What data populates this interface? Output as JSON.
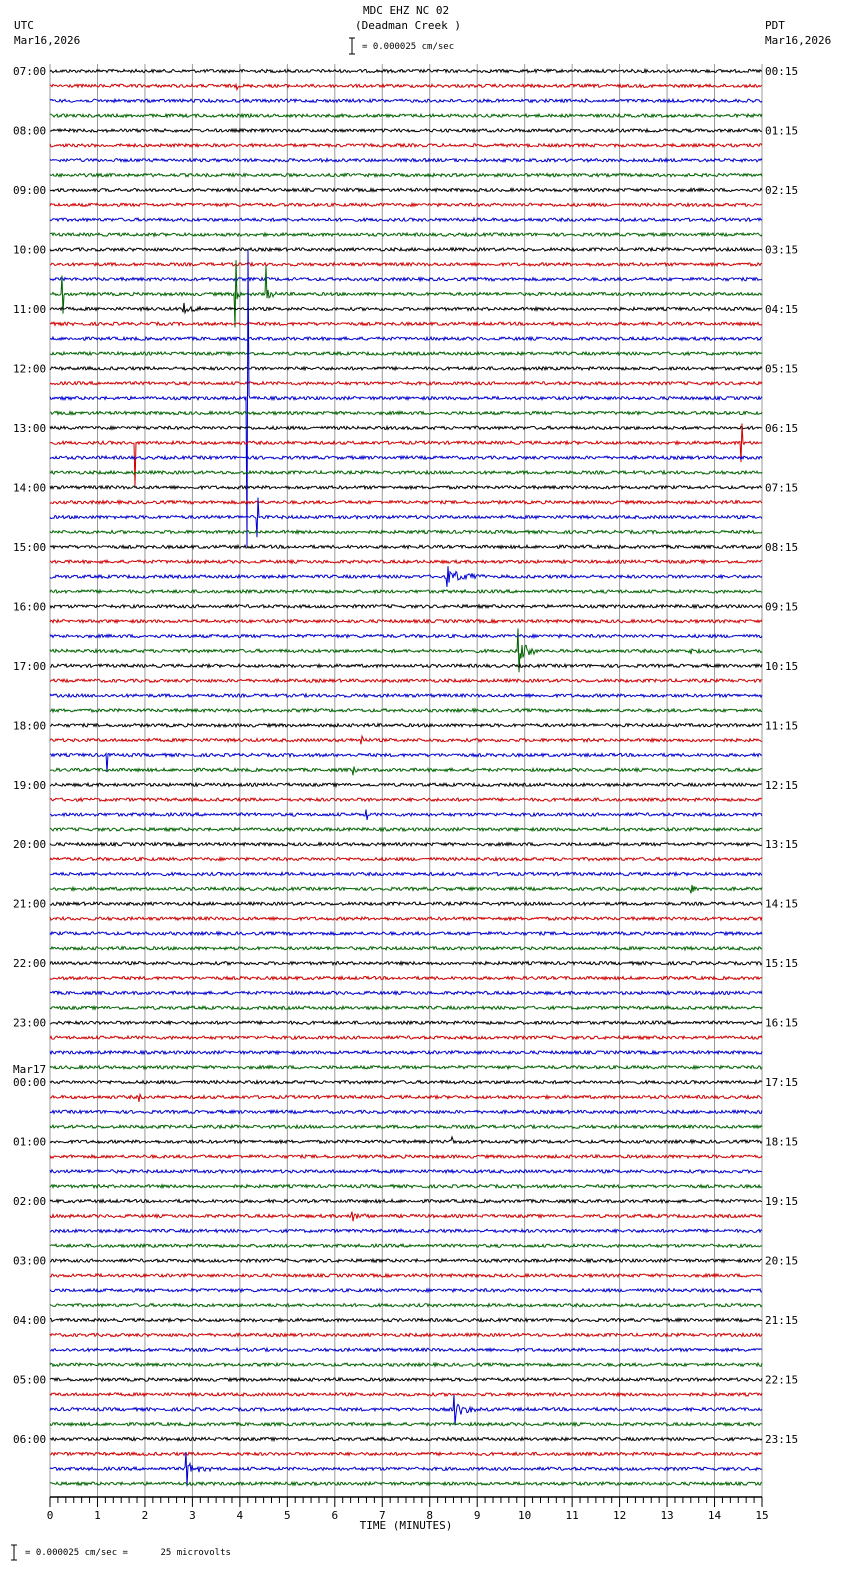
{
  "header": {
    "title": "MDC EHZ NC 02",
    "subtitle": "(Deadman Creek )",
    "scale_text": "= 0.000025 cm/sec",
    "left_tz": "UTC",
    "left_date": "Mar16,2026",
    "right_tz": "PDT",
    "right_date": "Mar16,2026"
  },
  "footer": {
    "scale_text": "= 0.000025 cm/sec =      25 microvolts"
  },
  "chart_data": {
    "type": "line",
    "title": "MDC EHZ NC 02 (Deadman Creek )",
    "xlabel": "TIME (MINUTES)",
    "xlim": [
      0,
      15
    ],
    "x_ticks": [
      "0",
      "1",
      "2",
      "3",
      "4",
      "5",
      "6",
      "7",
      "8",
      "9",
      "10",
      "11",
      "12",
      "13",
      "14",
      "15"
    ],
    "rows_per_hour": 4,
    "row_count": 96,
    "trace_colors": [
      "#000000",
      "#d00000",
      "#0000d0",
      "#006400"
    ],
    "grid": true,
    "left_labels": [
      "07:00",
      "08:00",
      "09:00",
      "10:00",
      "11:00",
      "12:00",
      "13:00",
      "14:00",
      "15:00",
      "16:00",
      "17:00",
      "18:00",
      "19:00",
      "20:00",
      "21:00",
      "22:00",
      "23:00",
      "00:00",
      "01:00",
      "02:00",
      "03:00",
      "04:00",
      "05:00",
      "06:00"
    ],
    "left_date_change": {
      "hour_index": 17,
      "label": "Mar17"
    },
    "right_labels": [
      "00:15",
      "01:15",
      "02:15",
      "03:15",
      "04:15",
      "05:15",
      "06:15",
      "07:15",
      "08:15",
      "09:15",
      "10:15",
      "11:15",
      "12:15",
      "13:15",
      "14:15",
      "15:15",
      "16:15",
      "17:15",
      "18:15",
      "19:15",
      "20:15",
      "21:15",
      "22:15",
      "23:15"
    ],
    "events": [
      {
        "row": 1,
        "minute": 3.9,
        "amp": 0.3,
        "coda": 0
      },
      {
        "row": 15,
        "minute": 0.25,
        "amp": 2.5,
        "coda": 0
      },
      {
        "row": 15,
        "minute": 3.88,
        "amp": 4.5,
        "coda": 0.3
      },
      {
        "row": 15,
        "minute": 4.53,
        "amp": 4.0,
        "coda": 0.4
      },
      {
        "row": 16,
        "minute": 2.8,
        "amp": 0.6,
        "coda": 0.7
      },
      {
        "row": 22,
        "minute": 4.15,
        "amp": 20,
        "coda": 0.1
      },
      {
        "row": 25,
        "minute": 1.77,
        "amp": 6.0,
        "coda": 0
      },
      {
        "row": 25,
        "minute": 14.55,
        "amp": 2.5,
        "coda": 0
      },
      {
        "row": 30,
        "minute": 4.35,
        "amp": 2.5,
        "coda": 0.1
      },
      {
        "row": 34,
        "minute": 8.35,
        "amp": 1.5,
        "coda": 1.2
      },
      {
        "row": 39,
        "minute": 9.85,
        "amp": 3.0,
        "coda": 0.8
      },
      {
        "row": 39,
        "minute": 13.5,
        "amp": 0.3,
        "coda": 0.6
      },
      {
        "row": 45,
        "minute": 6.55,
        "amp": 0.6,
        "coda": 0.1
      },
      {
        "row": 46,
        "minute": 1.18,
        "amp": 2.5,
        "coda": 0.1
      },
      {
        "row": 47,
        "minute": 6.38,
        "amp": 0.6,
        "coda": 0.1
      },
      {
        "row": 50,
        "minute": 6.65,
        "amp": 0.7,
        "coda": 0.05
      },
      {
        "row": 55,
        "minute": 13.5,
        "amp": 0.6,
        "coda": 0.2
      },
      {
        "row": 69,
        "minute": 1.87,
        "amp": 0.5,
        "coda": 0
      },
      {
        "row": 72,
        "minute": 8.45,
        "amp": 0.7,
        "coda": 0.2
      },
      {
        "row": 77,
        "minute": 6.35,
        "amp": 0.6,
        "coda": 0.6
      },
      {
        "row": 90,
        "minute": 8.5,
        "amp": 2.0,
        "coda": 0.8
      },
      {
        "row": 94,
        "minute": 2.85,
        "amp": 2.2,
        "coda": 0.6
      }
    ]
  }
}
